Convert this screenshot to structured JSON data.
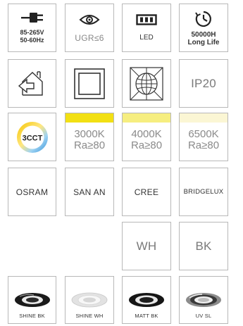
{
  "row1": {
    "voltage_line1": "85-265V",
    "voltage_line2": "50-60Hz",
    "ugr": "UGR≤6",
    "led": "LED",
    "life_line1": "50000H",
    "life_line2": "Long Life"
  },
  "row2": {
    "ip": "IP20",
    "icons": [
      "home-arrow-icon",
      "double-frame-icon",
      "globe-grid-icon"
    ]
  },
  "cct": {
    "badge": "3CCT",
    "options": [
      {
        "temp": "3000K",
        "ra": "Ra≥80",
        "color": "#f2e014"
      },
      {
        "temp": "4000K",
        "ra": "Ra≥80",
        "color": "#f6ee80"
      },
      {
        "temp": "6500K",
        "ra": "Ra≥80",
        "color": "#fbf6d4"
      }
    ]
  },
  "brands": [
    "OSRAM",
    "SAN AN",
    "CREE",
    "BRIDGELUX"
  ],
  "colors": [
    "WH",
    "BK"
  ],
  "finishes": [
    "SHINE BK",
    "SHINE WH",
    "MATT BK",
    "UV SL"
  ]
}
